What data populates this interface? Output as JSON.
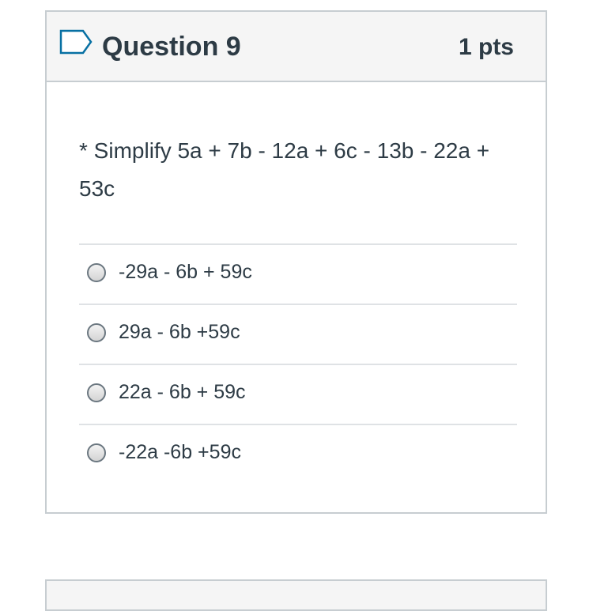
{
  "question": {
    "title": "Question 9",
    "points": "1 pts",
    "text": "* Simplify 5a + 7b - 12a + 6c - 13b - 22a + 53c",
    "flag_icon": "flag-outline-icon"
  },
  "answers": [
    {
      "label": "-29a - 6b + 59c"
    },
    {
      "label": "29a - 6b +59c"
    },
    {
      "label": "22a - 6b + 59c"
    },
    {
      "label": "-22a -6b +59c"
    }
  ],
  "colors": {
    "text": "#2d3b45",
    "border": "#c7cdd1",
    "header_bg": "#f5f5f5",
    "divider": "#dfe2e5"
  }
}
